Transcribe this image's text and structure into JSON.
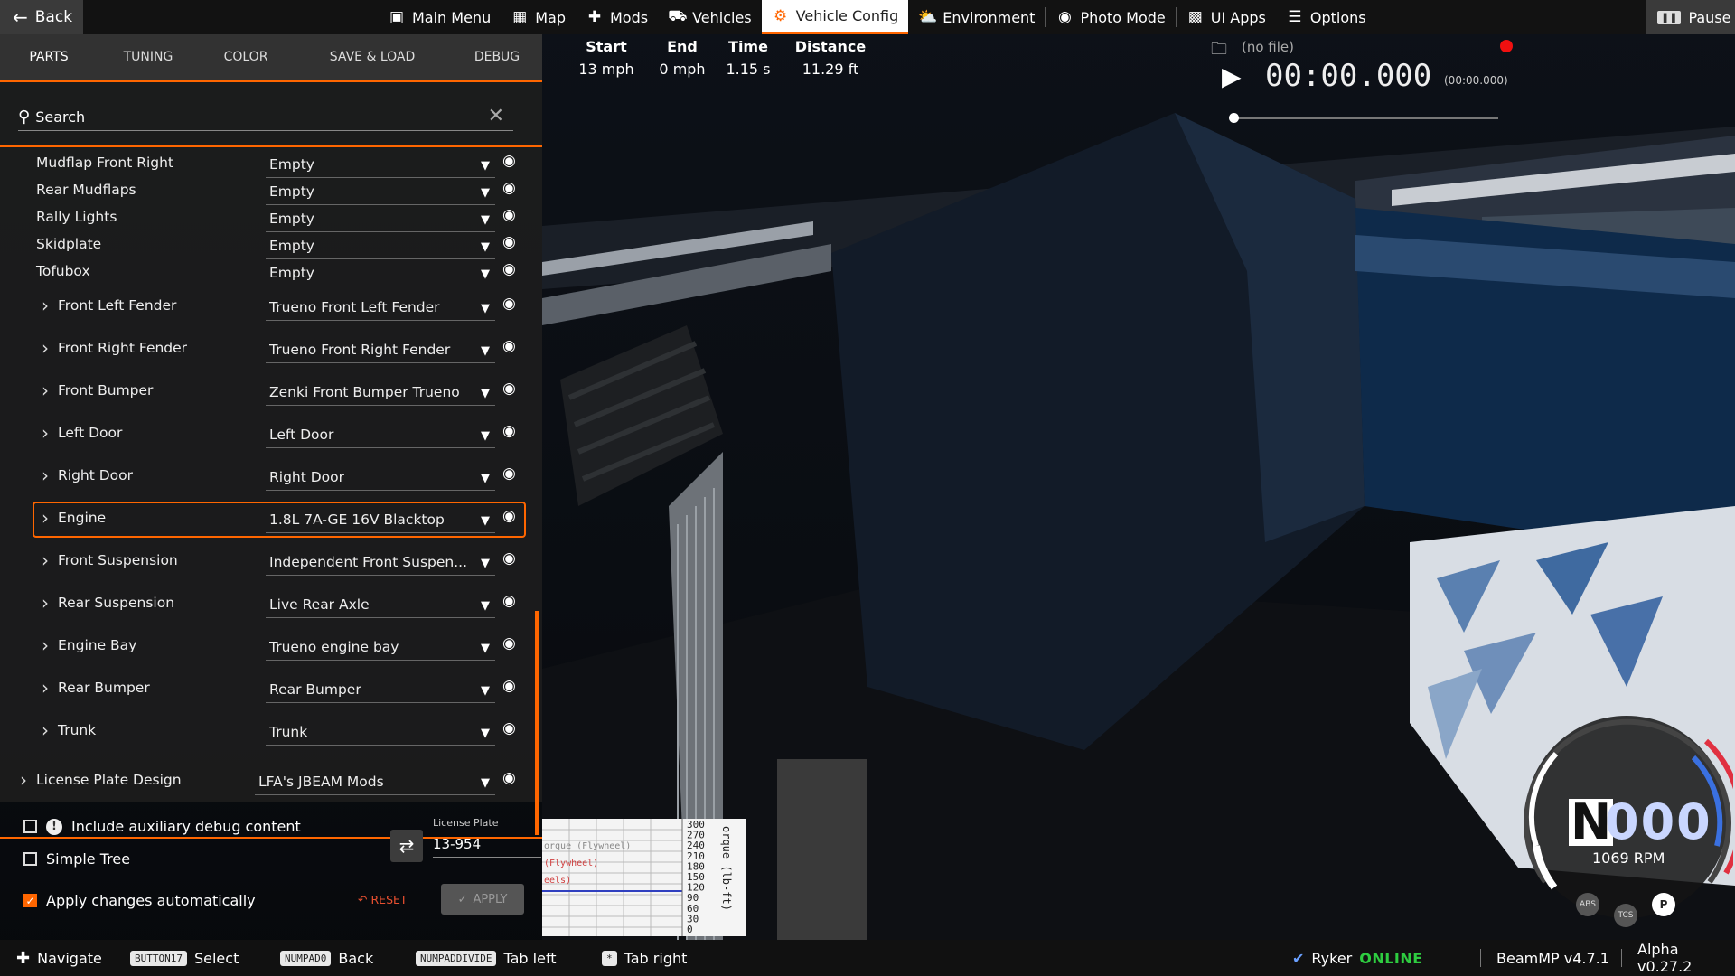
{
  "topbar": {
    "back_label": "Back",
    "pause_label": "Pause",
    "menu": [
      {
        "label": "Main Menu",
        "icon": "main-menu-icon"
      },
      {
        "label": "Map",
        "icon": "map-icon"
      },
      {
        "label": "Mods",
        "icon": "puzzle-icon"
      },
      {
        "label": "Vehicles",
        "icon": "car-icon"
      },
      {
        "label": "Vehicle Config",
        "icon": "vehicle-config-icon",
        "active": true
      },
      {
        "label": "Environment",
        "icon": "weather-icon"
      },
      {
        "label": "Photo Mode",
        "icon": "camera-icon"
      },
      {
        "label": "UI Apps",
        "icon": "ui-apps-icon"
      },
      {
        "label": "Options",
        "icon": "sliders-icon"
      }
    ]
  },
  "panel": {
    "tabs": [
      "PARTS",
      "TUNING",
      "COLOR",
      "SAVE & LOAD",
      "DEBUG"
    ],
    "active_tab": "PARTS",
    "search_label": "Search",
    "parts": [
      {
        "name": "Mudflap Front Right",
        "value": "Empty"
      },
      {
        "name": "Rear Mudflaps",
        "value": "Empty"
      },
      {
        "name": "Rally Lights",
        "value": "Empty"
      },
      {
        "name": "Skidplate",
        "value": "Empty"
      },
      {
        "name": "Tofubox",
        "value": "Empty"
      },
      {
        "name": "Front Left Fender",
        "value": "Trueno Front Left Fender"
      },
      {
        "name": "Front Right Fender",
        "value": "Trueno Front Right Fender"
      },
      {
        "name": "Front Bumper",
        "value": "Zenki Front Bumper Trueno"
      },
      {
        "name": "Left Door",
        "value": "Left Door"
      },
      {
        "name": "Right Door",
        "value": "Right Door"
      },
      {
        "name": "Engine",
        "value": "1.8L 7A-GE 16V Blacktop",
        "selected": true
      },
      {
        "name": "Front Suspension",
        "value": "Independent Front Suspen..."
      },
      {
        "name": "Rear Suspension",
        "value": "Live Rear Axle"
      },
      {
        "name": "Engine Bay",
        "value": "Trueno engine bay"
      },
      {
        "name": "Rear Bumper",
        "value": "Rear Bumper"
      },
      {
        "name": "Trunk",
        "value": "Trunk"
      },
      {
        "name": "License Plate Design",
        "value": "LFA's JBEAM Mods"
      }
    ],
    "options": {
      "aux_debug": "Include auxiliary debug content",
      "simple_tree": "Simple Tree",
      "apply_auto": "Apply changes automatically"
    },
    "license_plate_label": "License Plate",
    "license_plate_value": "13-954",
    "reset_label": "RESET",
    "apply_label": "APPLY"
  },
  "stats": {
    "columns": [
      {
        "header": "Start",
        "value": "13 mph"
      },
      {
        "header": "End",
        "value": "0 mph"
      },
      {
        "header": "Time",
        "value": "1.15 s"
      },
      {
        "header": "Distance",
        "value": "11.29 ft"
      }
    ]
  },
  "replay": {
    "file": "(no file)",
    "time": "00:00.000",
    "time_small": "(00:00.000)"
  },
  "graph": {
    "axis_label": "orque (lb-ft)",
    "ticks": [
      "300",
      "270",
      "240",
      "210",
      "180",
      "150",
      "120",
      "90",
      "60",
      "30",
      "0"
    ],
    "legend": [
      "orque (Flywheel)",
      "(Flywheel)",
      "eels)"
    ]
  },
  "gauge": {
    "gear": "N",
    "speed": "000",
    "rpm": "1069 RPM",
    "buttons": [
      "ABS",
      "TCS",
      "P"
    ]
  },
  "bottombar": {
    "navigate": "Navigate",
    "select_key": "BUTTON17",
    "select": "Select",
    "back_key": "NUMPAD0",
    "back": "Back",
    "tableft_key": "NUMPADDIVIDE",
    "tableft": "Tab left",
    "tabright_key": "*",
    "tabright": "Tab right",
    "user": "Ryker",
    "status": "ONLINE",
    "beammp": "BeamMP v4.7.1",
    "version": "Alpha v0.27.2"
  },
  "colors": {
    "accent": "#ff6600",
    "online": "#2ecc40",
    "record": "#f01010"
  }
}
